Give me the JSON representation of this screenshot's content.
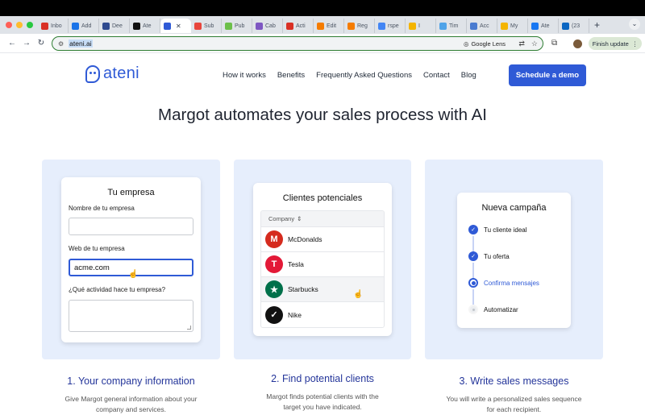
{
  "browser": {
    "tabs": [
      {
        "label": "Inbo",
        "color": "#d93025"
      },
      {
        "label": "Add",
        "color": "#1a73e8"
      },
      {
        "label": "Dee",
        "color": "#2e4a8f"
      },
      {
        "label": "Ate",
        "color": "#111111"
      },
      {
        "label": "",
        "color": "#2f5ad6"
      },
      {
        "label": "Sub",
        "color": "#e8453c"
      },
      {
        "label": "Pub",
        "color": "#6cbf4a"
      },
      {
        "label": "Cab",
        "color": "#7e57c2"
      },
      {
        "label": "Acti",
        "color": "#d93025"
      },
      {
        "label": "Edit",
        "color": "#f57c00"
      },
      {
        "label": "Reg",
        "color": "#f57c00"
      },
      {
        "label": "rspe",
        "color": "#4285f4"
      },
      {
        "label": "I",
        "color": "#f4b400"
      },
      {
        "label": "Tim",
        "color": "#4fa3e8"
      },
      {
        "label": "Acc",
        "color": "#4a7bd0"
      },
      {
        "label": "My",
        "color": "#f4b400"
      },
      {
        "label": "Ate",
        "color": "#1877f2"
      },
      {
        "label": "(23",
        "color": "#0a66c2"
      }
    ],
    "active_tab_index": 4,
    "url": "ateni.ai",
    "lens_label": "Google Lens",
    "update_label": "Finish update"
  },
  "site": {
    "logo": "ateni",
    "nav": [
      "How it works",
      "Benefits",
      "Frequently Asked Questions",
      "Contact",
      "Blog"
    ],
    "cta": "Schedule a demo",
    "headline": "Margot automates your sales process with AI"
  },
  "form_card": {
    "title": "Tu empresa",
    "name_label": "Nombre de tu empresa",
    "name_value": "",
    "web_label": "Web de tu empresa",
    "web_value": "acme.com",
    "activity_label": "¿Qué actividad hace tu empresa?",
    "activity_value": ""
  },
  "leads_card": {
    "title": "Clientes potenciales",
    "column": "Company",
    "rows": [
      {
        "name": "McDonalds",
        "color": "#d52b1e",
        "glyph": "M"
      },
      {
        "name": "Tesla",
        "color": "#e31937",
        "glyph": "T"
      },
      {
        "name": "Starbucks",
        "color": "#00704a",
        "glyph": "★"
      },
      {
        "name": "Nike",
        "color": "#111111",
        "glyph": "✓"
      }
    ]
  },
  "campaign_card": {
    "title": "Nueva campaña",
    "steps": [
      {
        "label": "Tu cliente ideal",
        "state": "done"
      },
      {
        "label": "Tu oferta",
        "state": "done"
      },
      {
        "label": "Confirma mensajes",
        "state": "current"
      },
      {
        "label": "Automatizar",
        "state": "todo"
      }
    ]
  },
  "steps": [
    {
      "title": "1. Your company information",
      "desc_line1": "Give Margot general information about your",
      "desc_line2": "company and services."
    },
    {
      "title": "2. Find potential clients",
      "desc_line1": "Margot finds potential clients with the",
      "desc_line2": "target you have indicated."
    },
    {
      "title": "3. Write sales messages",
      "desc_line1": "You will write a personalized sales sequence",
      "desc_line2": "for each recipient."
    }
  ],
  "colors": {
    "brand": "#2f5ad6",
    "card_bg": "#e6eefc",
    "caption": "#24359a"
  }
}
